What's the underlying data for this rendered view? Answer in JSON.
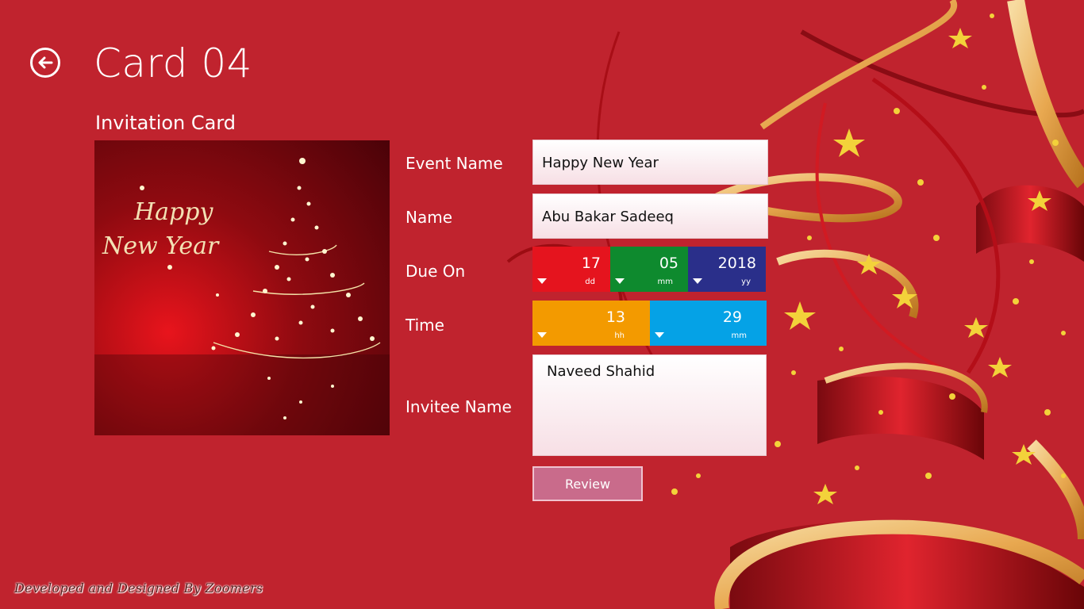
{
  "header": {
    "title": "Card 04",
    "subtitle": "Invitation Card"
  },
  "preview": {
    "line1": "Happy",
    "line2": "New Year"
  },
  "form": {
    "event_name_label": "Event Name",
    "event_name_value": "Happy New Year",
    "name_label": "Name",
    "name_value": "Abu Bakar Sadeeq",
    "due_on_label": "Due On",
    "due_on": {
      "day": "17",
      "day_unit": "dd",
      "month": "05",
      "month_unit": "mm",
      "year": "2018",
      "year_unit": "yy"
    },
    "time_label": "Time",
    "time": {
      "hour": "13",
      "hour_unit": "hh",
      "minute": "29",
      "minute_unit": "mm"
    },
    "invitee_label": "Invitee Name",
    "invitee_value": "Naveed Shahid",
    "review_label": "Review"
  },
  "footer": {
    "credit": "Developed and Designed By Zoomers"
  },
  "colors": {
    "background": "#c0232e",
    "day_picker": "#e5141e",
    "month_picker": "#0e8a2e",
    "year_picker": "#2a2f8a",
    "hour_picker": "#f39a00",
    "minute_picker": "#05a2e6",
    "review_button": "#c96b8b"
  },
  "icons": {
    "back": "back-arrow-icon",
    "dropdown": "chevron-down-icon"
  }
}
